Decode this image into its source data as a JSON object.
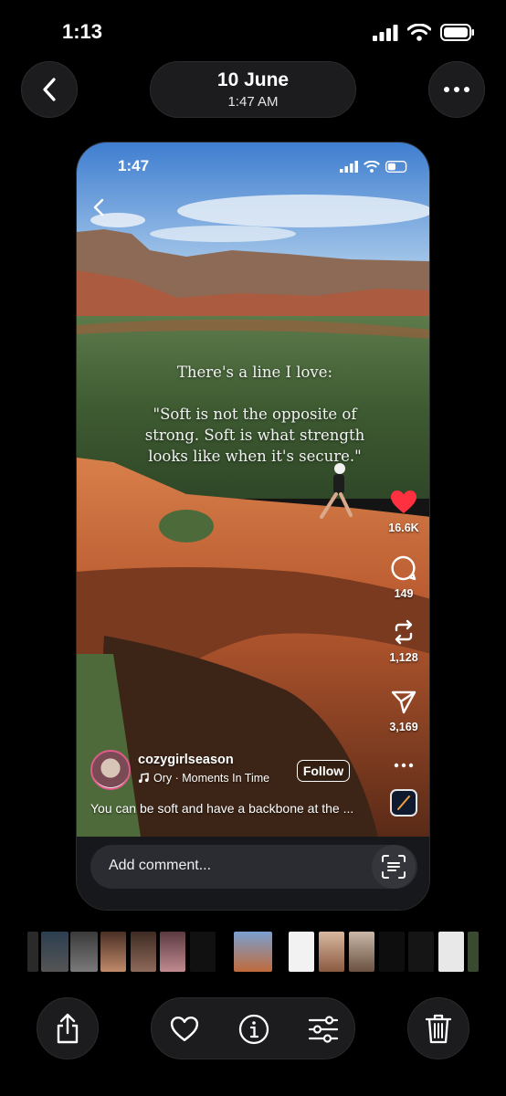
{
  "status_bar": {
    "time": "1:13"
  },
  "header": {
    "date": "10 June",
    "time": "1:47 AM"
  },
  "post": {
    "inner_time": "1:47",
    "quote": "There's a line I love:\n\n\"Soft is not the opposite of strong. Soft is what strength looks like when it's secure.\"",
    "likes": "16.6K",
    "comments": "149",
    "reposts": "1,128",
    "shares": "3,169",
    "username": "cozygirlseason",
    "music": "Ory · Moments In Time",
    "follow_label": "Follow",
    "caption": "You can be soft and have a backbone at the ...",
    "comment_placeholder": "Add comment..."
  },
  "colors": {
    "like": "#ff3040",
    "background": "#000000",
    "control": "#1c1c1e"
  },
  "icons": [
    "back-icon",
    "more-icon",
    "heart-icon",
    "comment-icon",
    "repost-icon",
    "send-icon",
    "scan-text-icon",
    "share-icon",
    "info-icon",
    "adjust-icon",
    "trash-icon"
  ]
}
